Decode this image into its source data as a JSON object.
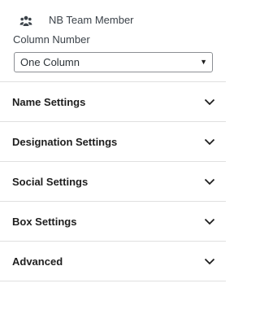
{
  "block": {
    "icon": "team-members-icon",
    "title": "NB Team Member"
  },
  "column_number": {
    "label": "Column Number",
    "selected": "One Column"
  },
  "panels": [
    {
      "title": "Name Settings",
      "icon": "chevron-down-icon"
    },
    {
      "title": "Designation Settings",
      "icon": "chevron-down-icon"
    },
    {
      "title": "Social Settings",
      "icon": "chevron-down-icon"
    },
    {
      "title": "Box Settings",
      "icon": "chevron-down-icon"
    },
    {
      "title": "Advanced",
      "icon": "chevron-down-icon"
    }
  ]
}
